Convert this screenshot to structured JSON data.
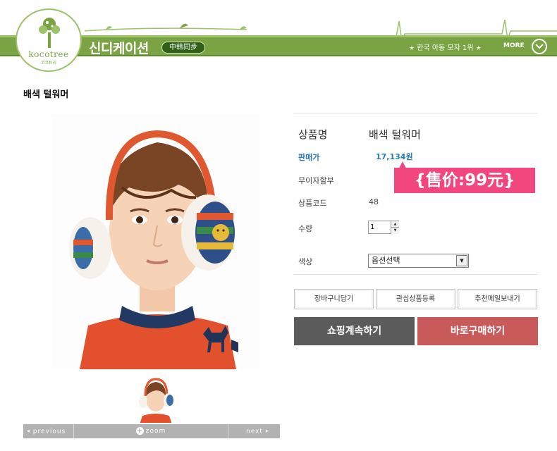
{
  "header": {
    "logo_text": "kocotree",
    "logo_subtext": "코코트리",
    "brand_title": "신디케이션",
    "brand_badge": "中韩同步",
    "tagline": "한국 아동 모자 1위",
    "more_label": "MORE"
  },
  "product": {
    "title": "배색 털워머",
    "fields": {
      "name_label": "상품명",
      "name_value": "배색 털워머",
      "price_label": "판매가",
      "price_value": "17,134원",
      "installment_label": "무이자할부",
      "code_label": "상품코드",
      "code_value": "48",
      "quantity_label": "수량",
      "quantity_value": "1",
      "color_label": "색상",
      "color_selected": "옵션선택"
    },
    "price_callout": "{售价:99元}"
  },
  "image_nav": {
    "previous": "previous",
    "zoom": "zoom",
    "next": "next"
  },
  "actions": {
    "cart": "장바구니담기",
    "wishlist": "관심상품등록",
    "recommend": "추천메일보내기",
    "continue_shopping": "쇼핑계속하기",
    "buy_now": "바로구매하기"
  },
  "colors": {
    "brand_green": "#7aa443",
    "price_blue": "#2a7bb6",
    "callout_pink": "#f2467f",
    "continue_gray": "#5b5b5b",
    "buy_red": "#c95a5a"
  }
}
